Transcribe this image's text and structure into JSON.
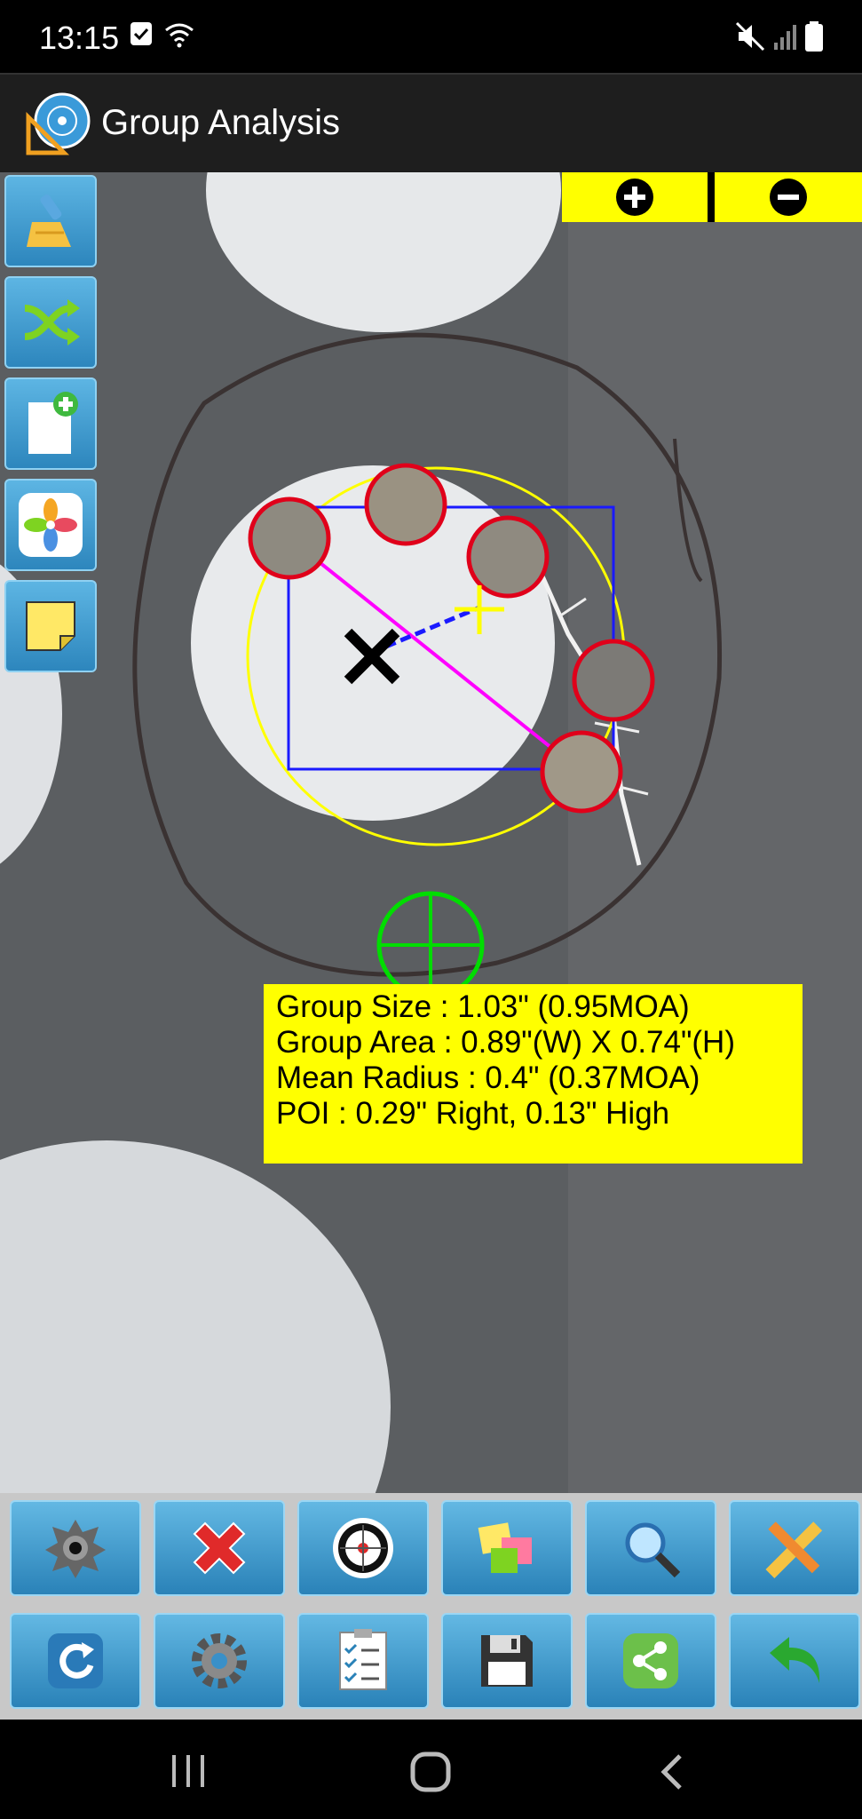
{
  "status_bar": {
    "time": "13:15",
    "icons": [
      "check-notification-icon",
      "wifi-icon",
      "mute-icon",
      "signal-icon",
      "battery-icon"
    ]
  },
  "app_bar": {
    "title": "Group Analysis",
    "icon": "target-ruler-logo-icon"
  },
  "zoom": {
    "in_icon": "zoom-in-plus-icon",
    "out_icon": "zoom-out-minus-icon"
  },
  "side_toolbar": [
    "clear-broom-icon",
    "shuffle-icon",
    "new-document-icon",
    "photos-gallery-icon",
    "sticky-note-icon"
  ],
  "info_box": {
    "group_size": "Group Size : 1.03\" (0.95MOA)",
    "group_area": "Group Area : 0.89\"(W) X 0.74\"(H)",
    "mean_radius": "Mean Radius : 0.4\" (0.37MOA)",
    "poi": "POI : 0.29\" Right,  0.13\" High"
  },
  "bottom_toolbar": {
    "row1": [
      "bullet-hole-icon",
      "delete-x-icon",
      "target-icon",
      "sticky-notes-icon",
      "magnifier-icon",
      "ruler-pencil-icon"
    ],
    "row2": [
      "refresh-icon",
      "settings-gear-icon",
      "checklist-icon",
      "save-floppy-icon",
      "share-icon",
      "undo-arrow-icon"
    ]
  },
  "colors": {
    "highlight": "#ffff00",
    "shot_circle": "#e0001a",
    "bounding_box": "#1a1aff",
    "extreme_spread": "#ff00ff",
    "group_circle": "#ffff00",
    "aim_point": "#00dd00"
  }
}
